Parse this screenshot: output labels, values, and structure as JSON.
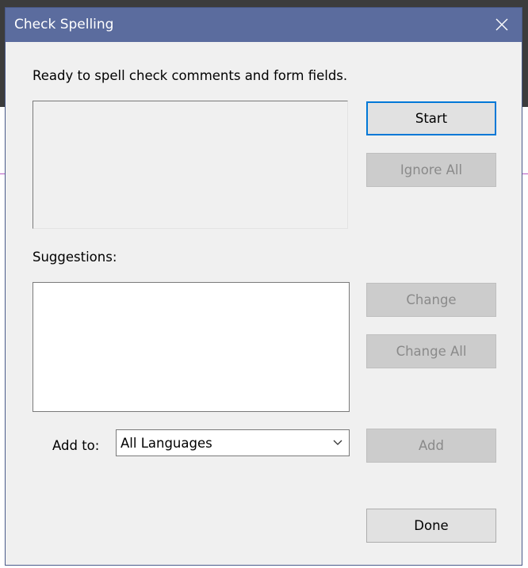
{
  "dialog": {
    "title": "Check Spelling",
    "status": "Ready to spell check comments and form fields.",
    "suggestions_label": "Suggestions:",
    "add_to_label": "Add to:",
    "language_selected": "All Languages",
    "buttons": {
      "start": "Start",
      "ignore_all": "Ignore All",
      "change": "Change",
      "change_all": "Change All",
      "add": "Add",
      "done": "Done"
    }
  },
  "colors": {
    "titlebar": "#5b6c9e",
    "dialog_bg": "#f0f0f0",
    "default_button_border": "#0078d7",
    "disabled_text": "#8a8a8a"
  },
  "icons": [
    "close-icon",
    "chevron-down-icon"
  ]
}
